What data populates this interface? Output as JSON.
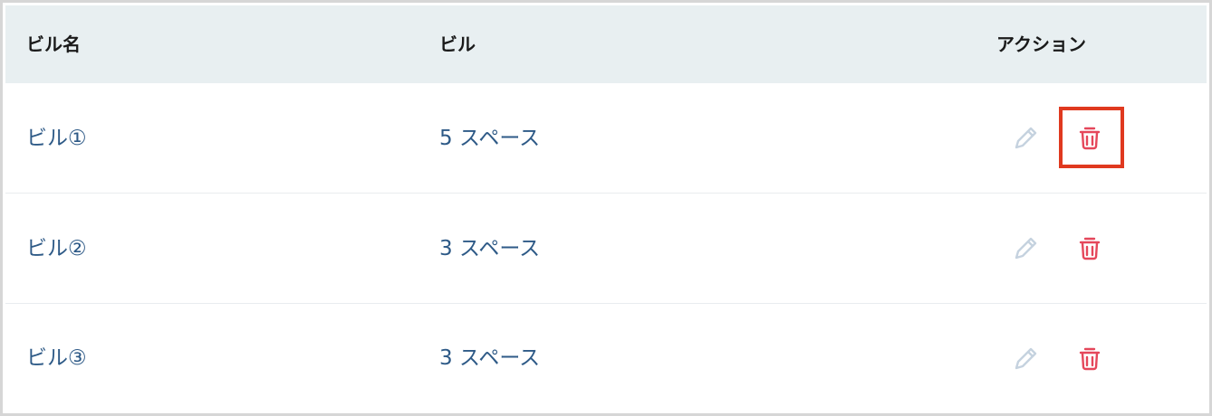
{
  "table": {
    "headers": {
      "name": "ビル名",
      "bill": "ビル",
      "action": "アクション"
    },
    "rows": [
      {
        "name": "ビル①",
        "bill": "5 スペース",
        "selected_delete": true
      },
      {
        "name": "ビル②",
        "bill": "3 スペース",
        "selected_delete": false
      },
      {
        "name": "ビル③",
        "bill": "3 スペース",
        "selected_delete": false
      }
    ]
  },
  "icons": {
    "edit": "pencil-icon",
    "delete": "trash-icon"
  },
  "colors": {
    "header_bg": "#e8eff1",
    "link_text": "#2e5a87",
    "edit_icon": "#c5d2df",
    "delete_icon": "#e5475b",
    "highlight": "#e0391f"
  }
}
